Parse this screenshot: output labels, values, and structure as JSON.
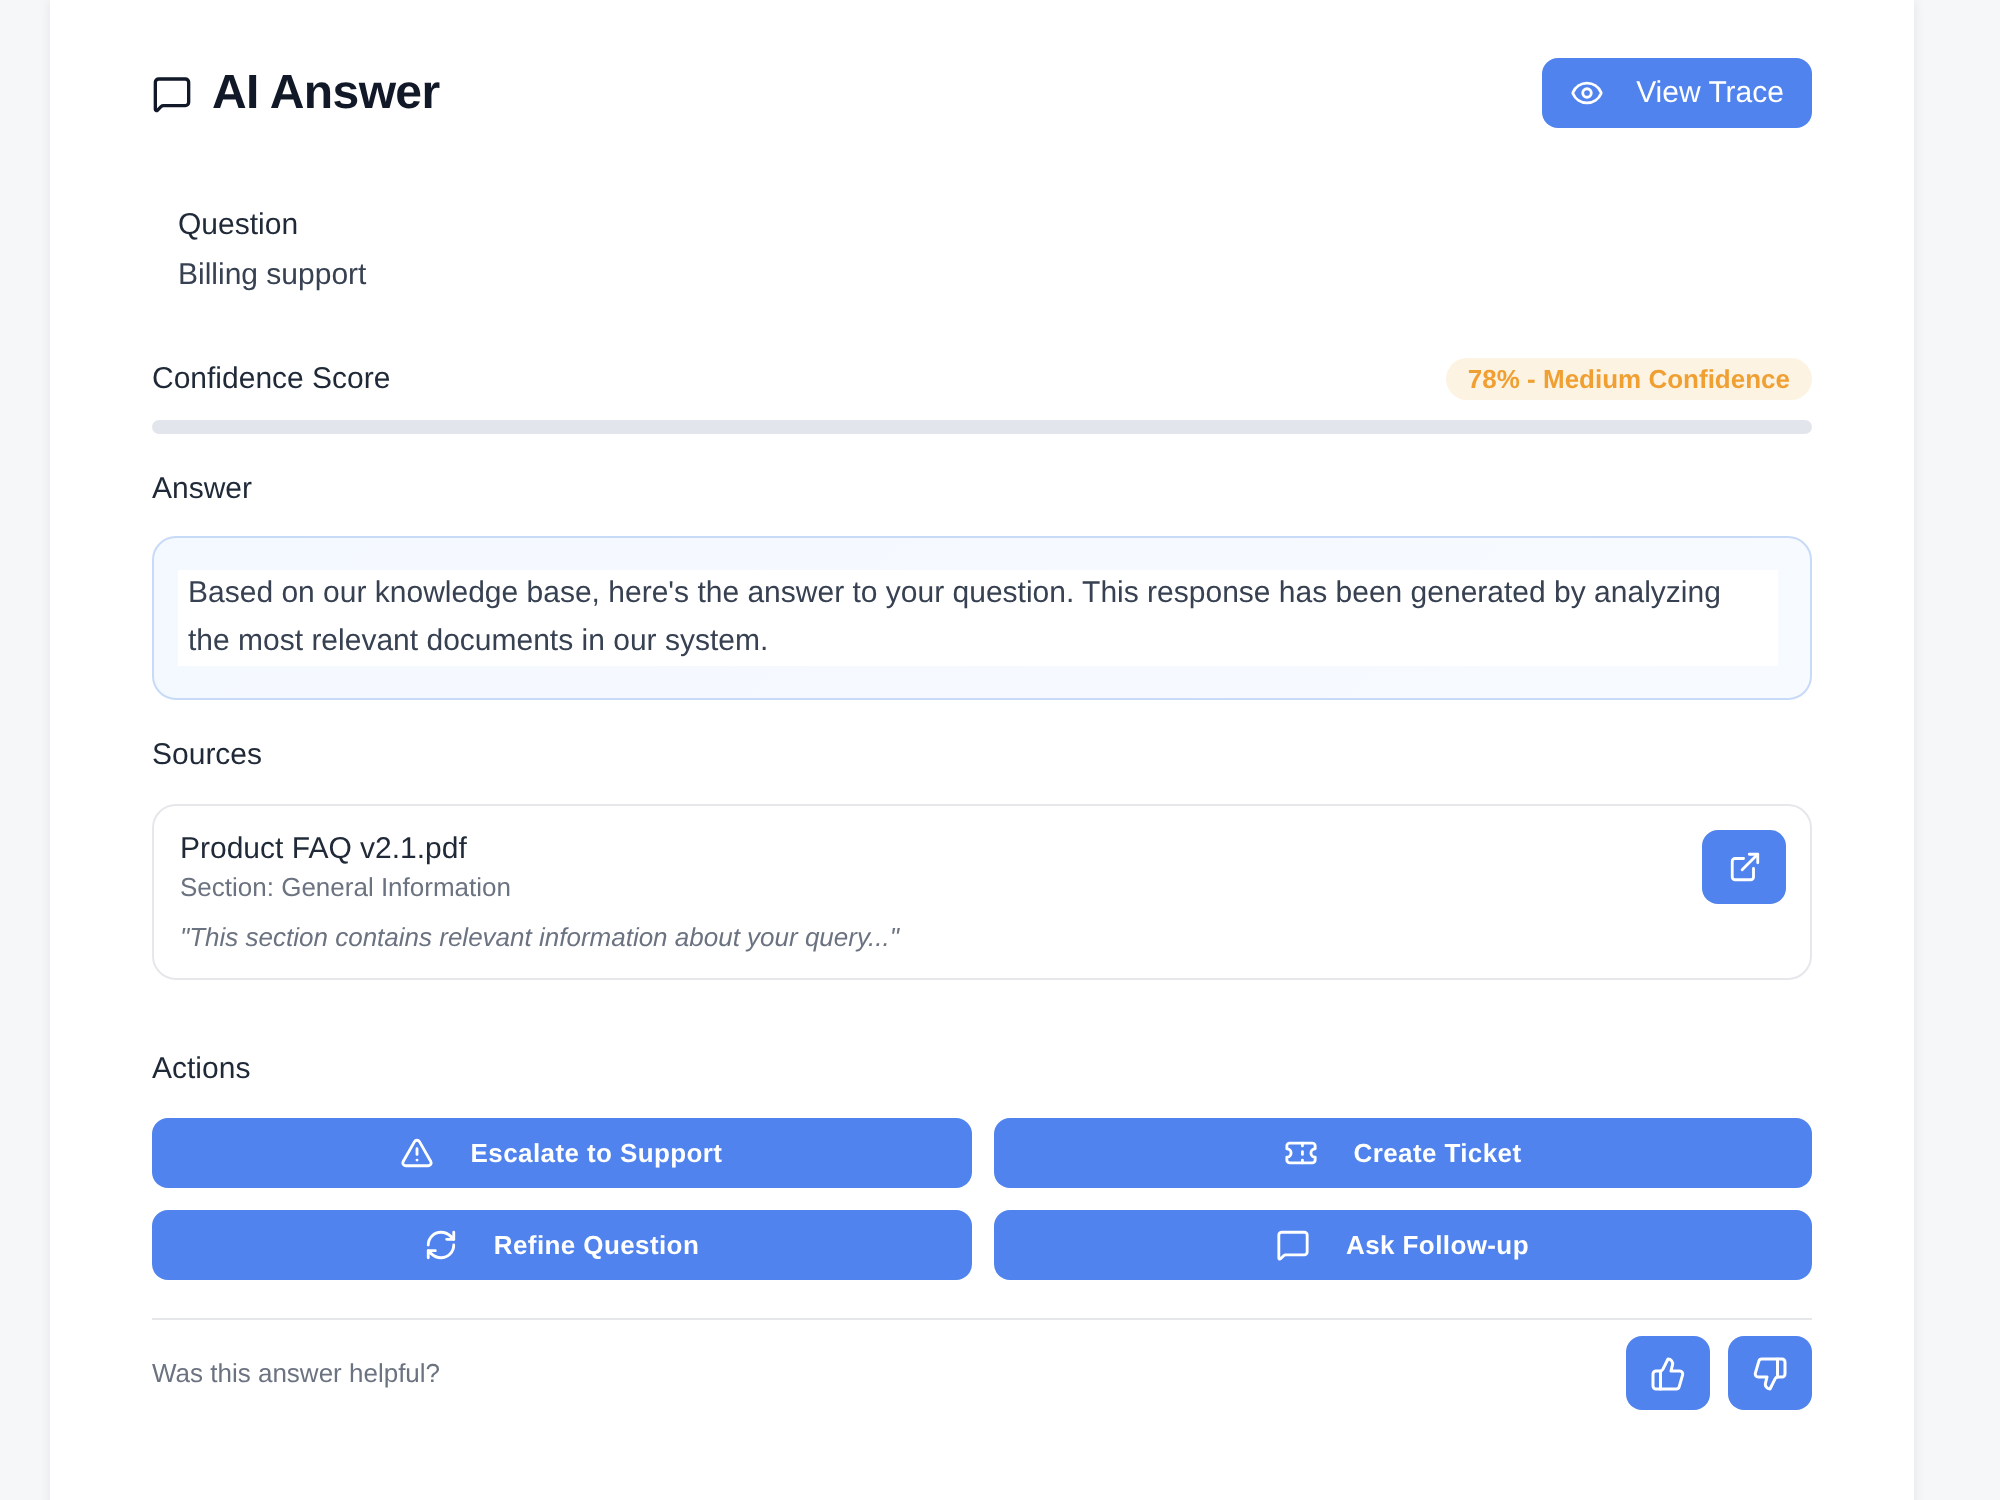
{
  "header": {
    "title": "AI Answer",
    "button": "View Trace"
  },
  "question": {
    "label": "Question",
    "text": "Billing support"
  },
  "confidence": {
    "label": "Confidence Score",
    "badge": "78% - Medium Confidence",
    "level": 0
  },
  "answer": {
    "label": "Answer",
    "text": "Based on our knowledge base, here's the answer to your question. This response has been generated by analyzing the most relevant documents in our system."
  },
  "sources": {
    "label": "Sources",
    "items": [
      {
        "title": "Product FAQ v2.1.pdf",
        "section": "Section: General Information",
        "excerpt": "\"This section contains relevant information about your query...\""
      }
    ]
  },
  "actions": {
    "label": "Actions",
    "buttons": [
      {
        "label": "Escalate to Support",
        "kind": "escalate"
      },
      {
        "label": "Create Ticket",
        "kind": "ticket"
      },
      {
        "label": "Refine Question",
        "kind": "refine"
      },
      {
        "label": "Ask Follow-up",
        "kind": "followup"
      }
    ]
  },
  "feedback": {
    "prompt": "Was this answer helpful?"
  }
}
